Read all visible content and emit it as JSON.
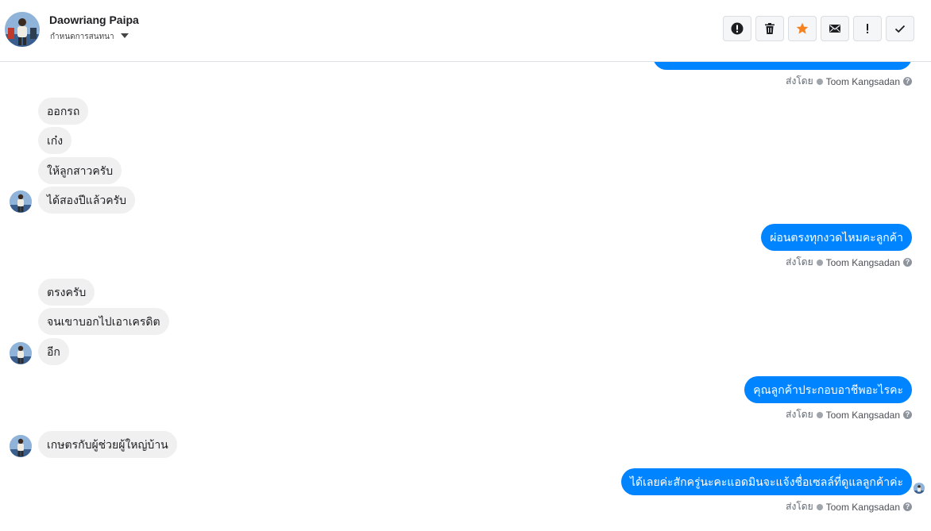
{
  "header": {
    "name": "Daowriang Paipa",
    "subtitle": "กำหนดการสนทนา"
  },
  "toolbar": {
    "icons": [
      "alert-circle-icon",
      "trash-icon",
      "star-icon",
      "mail-icon",
      "exclamation-icon",
      "check-icon"
    ],
    "star_color": "#f5821f"
  },
  "colors": {
    "outgoing": "#0084ff",
    "incoming": "#f0f0f0"
  },
  "meta": {
    "sent_by": "ส่งโดย",
    "agent": "Toom Kangsadan",
    "help": "?"
  },
  "messages": {
    "in1": "ออกรถ",
    "in2": "เก๋ง",
    "in3": "ให้ลูกสาวครับ",
    "in4": "ได้สองปีแล้วครับ",
    "out1": "ผ่อนตรงทุกงวดไหมคะลูกค้า",
    "in5": "ตรงครับ",
    "in6": "จนเขาบอกไปเอาเครดิต",
    "in7": "อีก",
    "out2": "คุณลูกค้าประกอบอาชีพอะไรคะ",
    "in8": "เกษตรกับผู้ช่วยผู้ใหญ่บ้าน",
    "out3": "ได้เลยค่ะสักครู่นะคะแอดมินจะแจ้งชื่อเซลล์ที่ดูแลลูกค้าค่ะ"
  }
}
